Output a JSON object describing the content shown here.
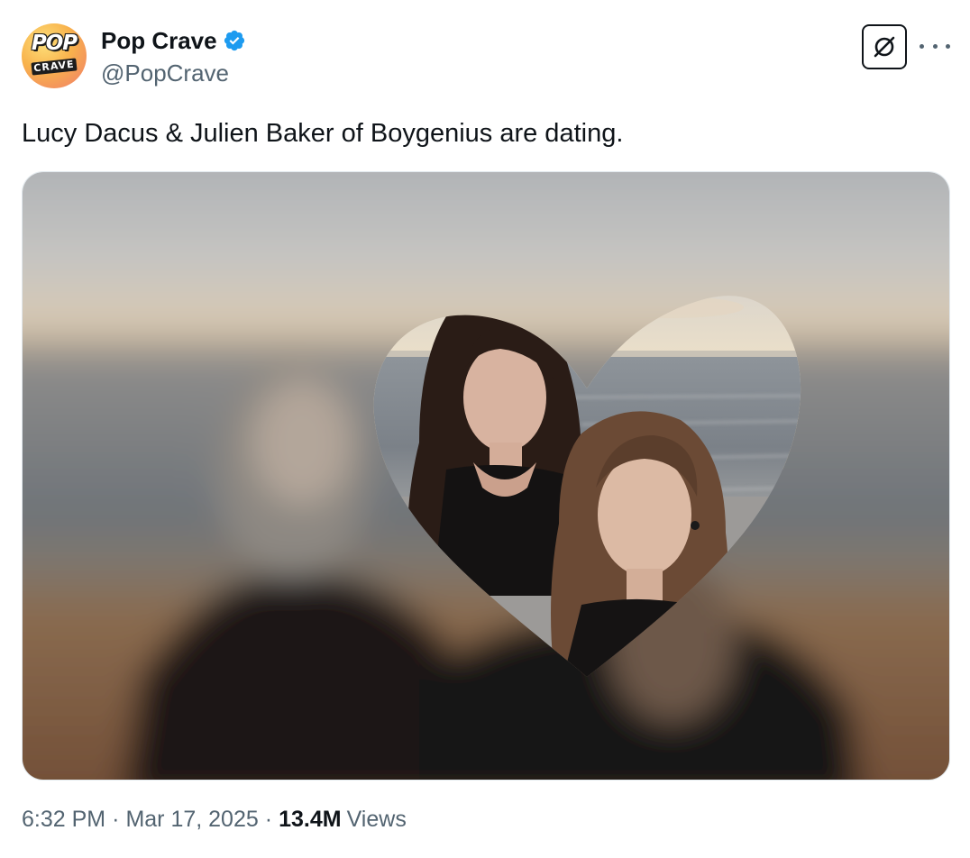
{
  "post": {
    "author": {
      "display_name": "Pop Crave",
      "handle": "@PopCrave",
      "verified": true,
      "avatar_text_top": "POP",
      "avatar_text_bottom": "CRAVE"
    },
    "text": "Lucy Dacus & Julien Baker of Boygenius are dating.",
    "timestamp_time": "6:32 PM",
    "timestamp_date": "Mar 17, 2025",
    "views_count": "13.4M",
    "views_label": "Views",
    "separator": "·"
  },
  "icons": {
    "verified": "verified-badge-icon",
    "grok": "grok-icon",
    "more": "more-dots-icon"
  },
  "colors": {
    "verified_blue": "#1d9bf0",
    "secondary_text": "#536471",
    "primary_text": "#0f1419"
  }
}
